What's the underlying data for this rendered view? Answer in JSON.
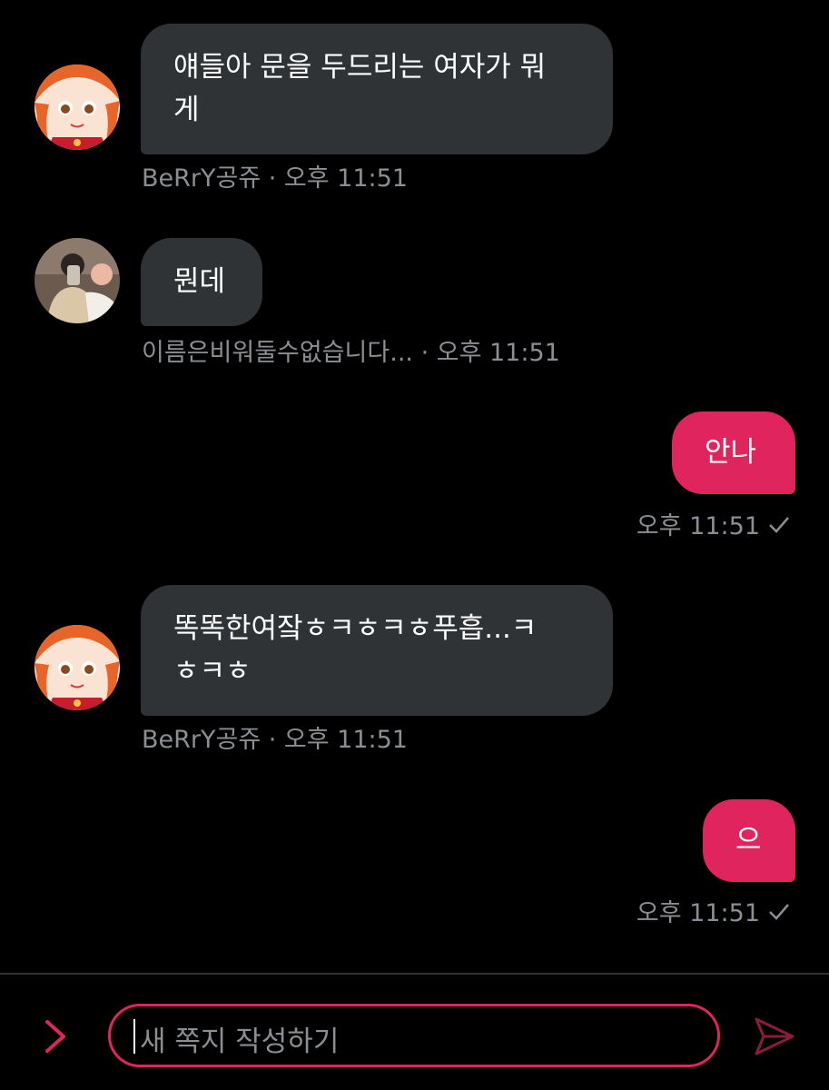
{
  "messages": [
    {
      "direction": "in",
      "sender": "BeRrY공쥬",
      "text": "얘들아 문을 두드리는 여자가 뭐\n게",
      "meta": "BeRrY공쥬 · 오후 11:51"
    },
    {
      "direction": "in",
      "sender": "이름은비워둘수없습니다...",
      "text": "뭔데",
      "meta": "이름은비워둘수없습니다... · 오후 11:51"
    },
    {
      "direction": "out",
      "text": "안나",
      "meta": "오후 11:51"
    },
    {
      "direction": "in",
      "sender": "BeRrY공쥬",
      "text": "똑똑한여잨ㅎㅋㅎㅋㅎ푸흡...ㅋ\nㅎㅋㅎ",
      "meta": "BeRrY공쥬 · 오후 11:51"
    },
    {
      "direction": "out",
      "text": "으",
      "meta": "오후 11:51"
    }
  ],
  "composer": {
    "placeholder": "새 쪽지 작성하기"
  },
  "icons": {
    "toggle": "chevron-right-icon",
    "send": "send-icon",
    "read": "checkmark-icon"
  },
  "colors": {
    "accent": "#e0245e",
    "incoming_bubble": "#2f3336",
    "meta_text": "#8b8f94",
    "background": "#000000"
  }
}
